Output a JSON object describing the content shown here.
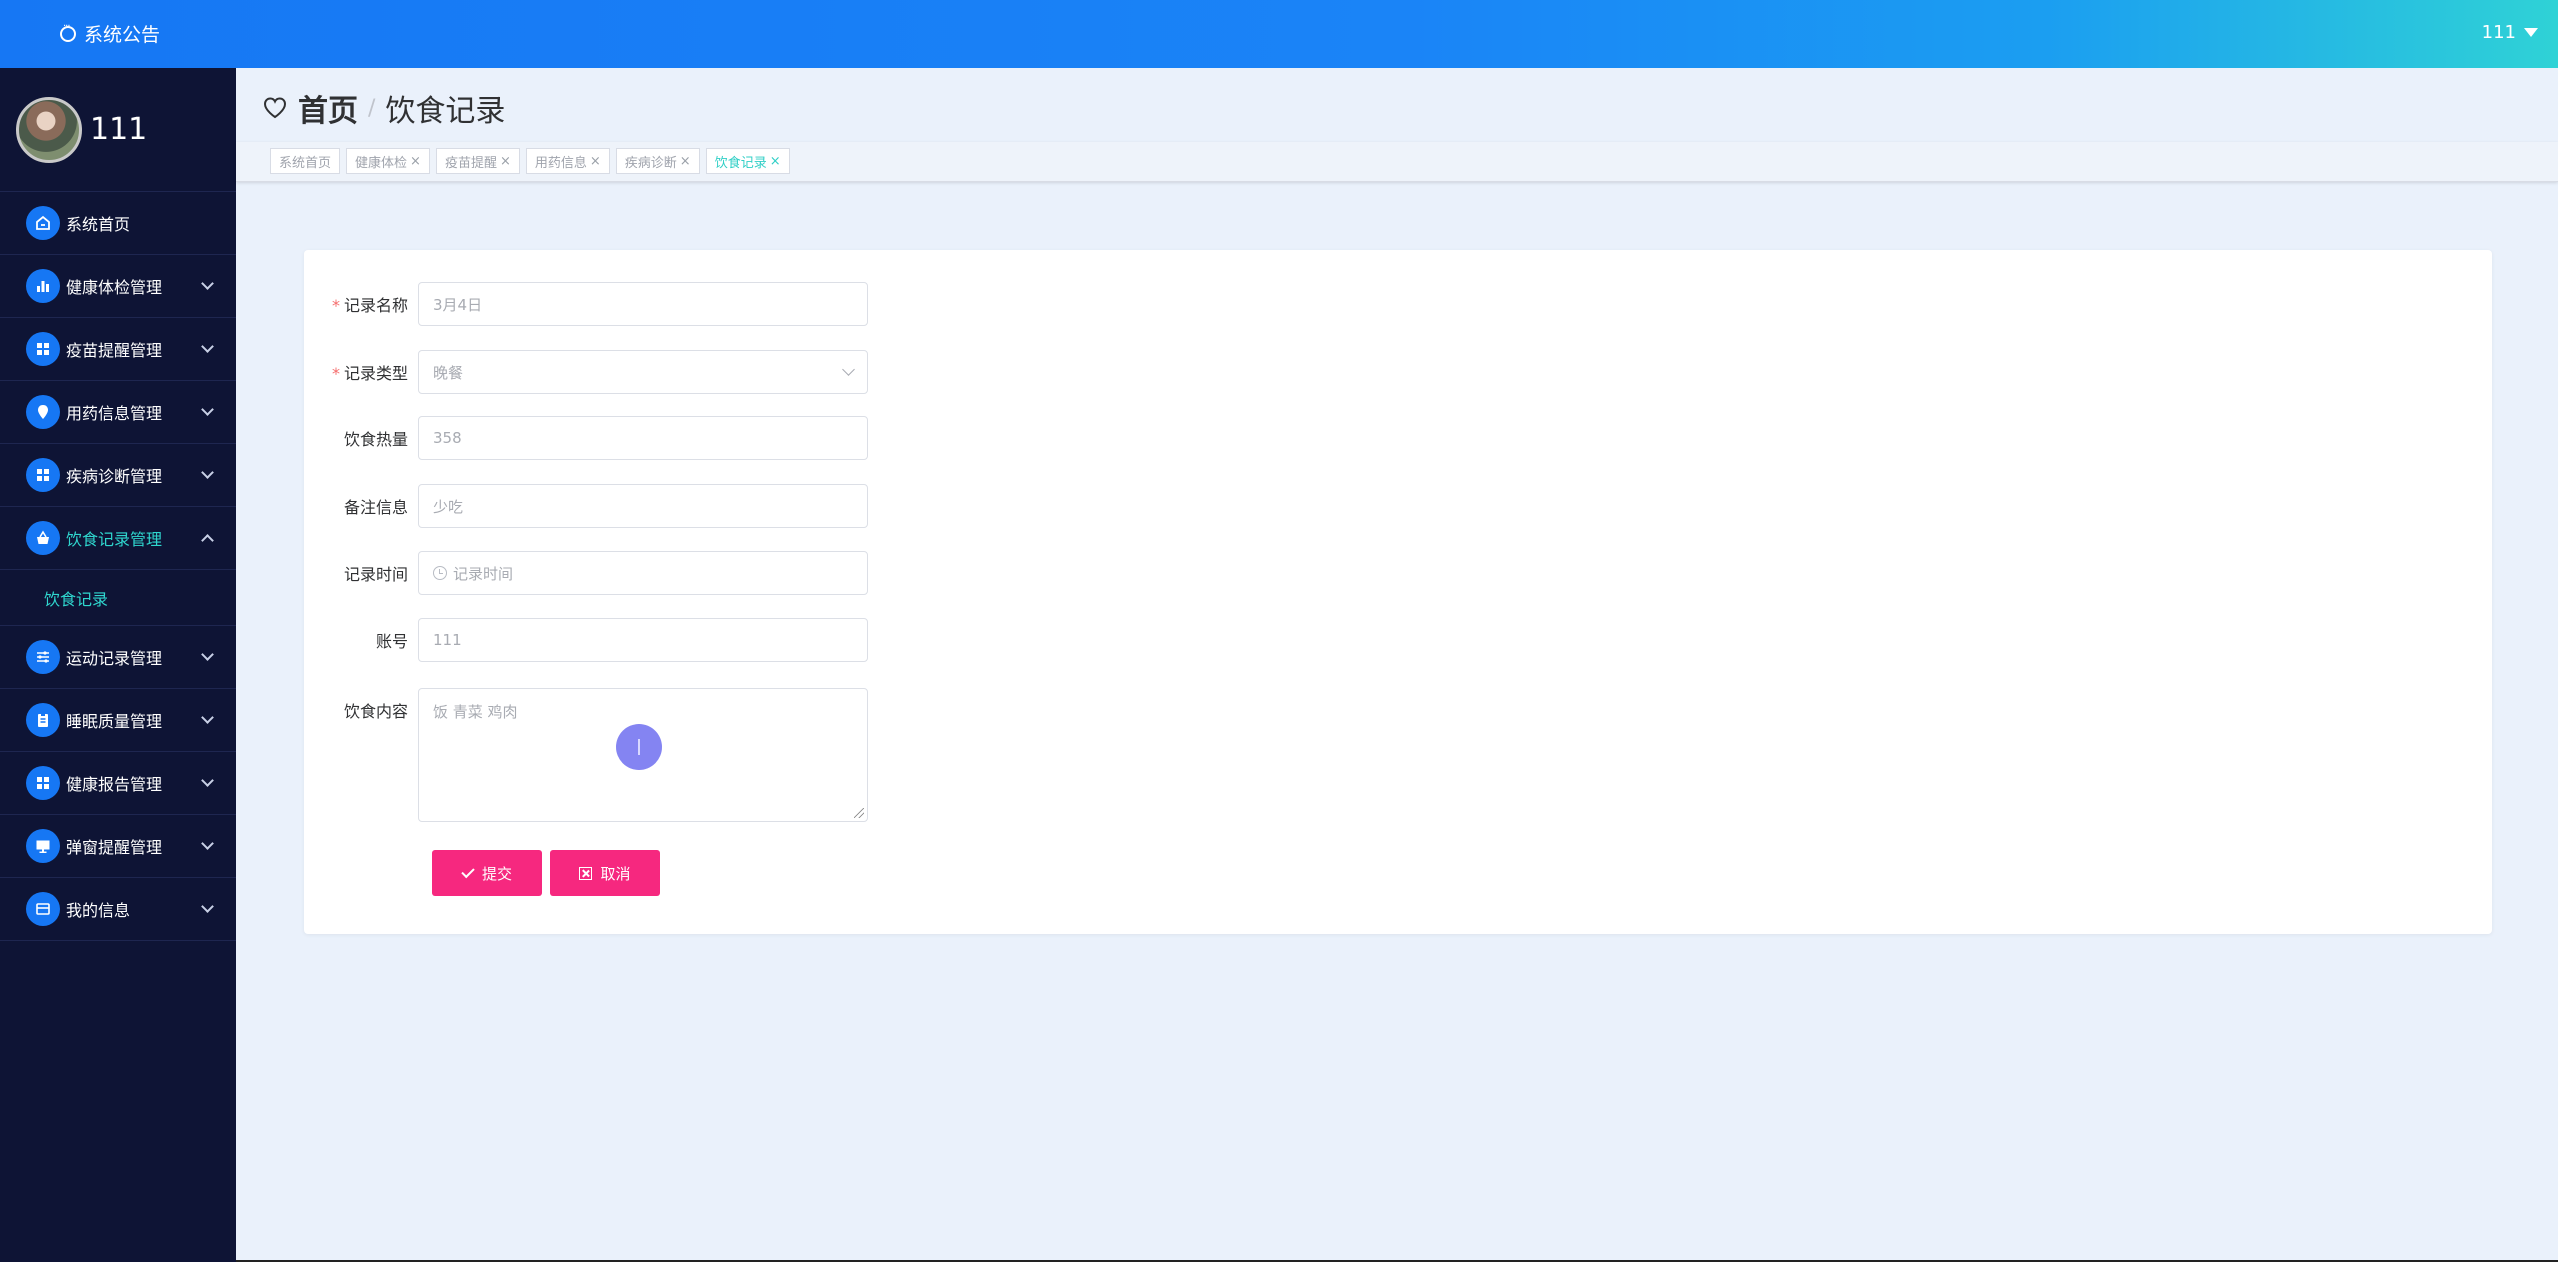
{
  "topbar": {
    "notice_label": "系统公告",
    "user_label": "111"
  },
  "sidebar": {
    "profile_name": "111",
    "items": [
      {
        "label": "系统首页",
        "icon": "home-icon",
        "has_chevron": false
      },
      {
        "label": "健康体检管理",
        "icon": "bar-chart-icon",
        "has_chevron": true
      },
      {
        "label": "疫苗提醒管理",
        "icon": "grid-icon",
        "has_chevron": true
      },
      {
        "label": "用药信息管理",
        "icon": "location-pin-icon",
        "has_chevron": true
      },
      {
        "label": "疾病诊断管理",
        "icon": "grid-icon",
        "has_chevron": true
      },
      {
        "label": "饮食记录管理",
        "icon": "basket-icon",
        "has_chevron": true,
        "expanded": true
      },
      {
        "label": "运动记录管理",
        "icon": "sliders-icon",
        "has_chevron": true
      },
      {
        "label": "睡眠质量管理",
        "icon": "clipboard-icon",
        "has_chevron": true
      },
      {
        "label": "健康报告管理",
        "icon": "grid-icon",
        "has_chevron": true
      },
      {
        "label": "弹窗提醒管理",
        "icon": "monitor-icon",
        "has_chevron": true
      },
      {
        "label": "我的信息",
        "icon": "card-icon",
        "has_chevron": true
      }
    ],
    "submenu": {
      "label": "饮食记录"
    }
  },
  "breadcrumb": {
    "home": "首页",
    "separator": "/",
    "current": "饮食记录"
  },
  "tags": [
    {
      "label": "系统首页",
      "closable": false,
      "active": false
    },
    {
      "label": "健康体检",
      "closable": true,
      "active": false
    },
    {
      "label": "疫苗提醒",
      "closable": true,
      "active": false
    },
    {
      "label": "用药信息",
      "closable": true,
      "active": false
    },
    {
      "label": "疾病诊断",
      "closable": true,
      "active": false
    },
    {
      "label": "饮食记录",
      "closable": true,
      "active": true
    }
  ],
  "tag_close_glyph": "×",
  "form": {
    "record_name": {
      "label": "记录名称",
      "required": true,
      "value": "3月4日"
    },
    "record_type": {
      "label": "记录类型",
      "required": true,
      "value": "晚餐"
    },
    "calories": {
      "label": "饮食热量",
      "required": false,
      "value": "358"
    },
    "remarks": {
      "label": "备注信息",
      "required": false,
      "value": "少吃"
    },
    "record_time": {
      "label": "记录时间",
      "required": false,
      "placeholder": "记录时间"
    },
    "account": {
      "label": "账号",
      "required": false,
      "value": "111"
    },
    "content": {
      "label": "饮食内容",
      "required": false,
      "value": "饭 青菜 鸡肉"
    },
    "required_mark": "*",
    "submit_label": "提交",
    "cancel_label": "取消"
  },
  "colors": {
    "topbar_start": "#1677f4",
    "topbar_end": "#2fd2d6",
    "sidebar_bg": "#0e1435",
    "icon_bg": "#1677f4",
    "active_text": "#2fd7cf",
    "button": "#f6287f",
    "required": "#f56c6c"
  }
}
